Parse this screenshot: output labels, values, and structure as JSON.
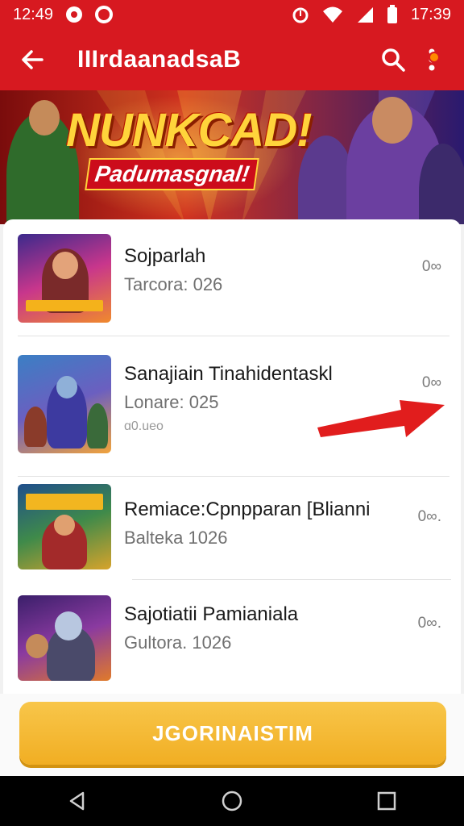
{
  "status_bar": {
    "time_left": "12:49",
    "time_right": "17:39"
  },
  "app_bar": {
    "title": "IIIrdaanadsaB"
  },
  "banner": {
    "headline": "NUNKCAD!",
    "tagline": "Padumasgnal!"
  },
  "list": {
    "items": [
      {
        "title": "Sojparlah",
        "subtitle": "Tarcora: 026",
        "extra": "",
        "more": "0∞"
      },
      {
        "title": "Sanajiain Tinahidentaskl",
        "subtitle": "Lonare: 025",
        "extra": "ɑ0.ueo",
        "more": "0∞"
      },
      {
        "title": "Remiace:Cpnpparan [Blianni",
        "subtitle": "Balteka 1026",
        "extra": "",
        "more": "0∞."
      },
      {
        "title": "Sajotiatii Pamianiala",
        "subtitle": "Gultora. 1026",
        "extra": "",
        "more": "0∞."
      }
    ]
  },
  "cta": {
    "label": "JGORINAISTIM"
  },
  "colors": {
    "primary": "#d71920",
    "accent": "#f1ae23",
    "arrow": "#e11d1d"
  },
  "icons": {
    "back": "arrow-left-icon",
    "search": "search-icon",
    "more": "more-vertical-icon",
    "nav_back": "triangle-back-icon",
    "nav_home": "circle-home-icon",
    "nav_recents": "square-recents-icon"
  }
}
